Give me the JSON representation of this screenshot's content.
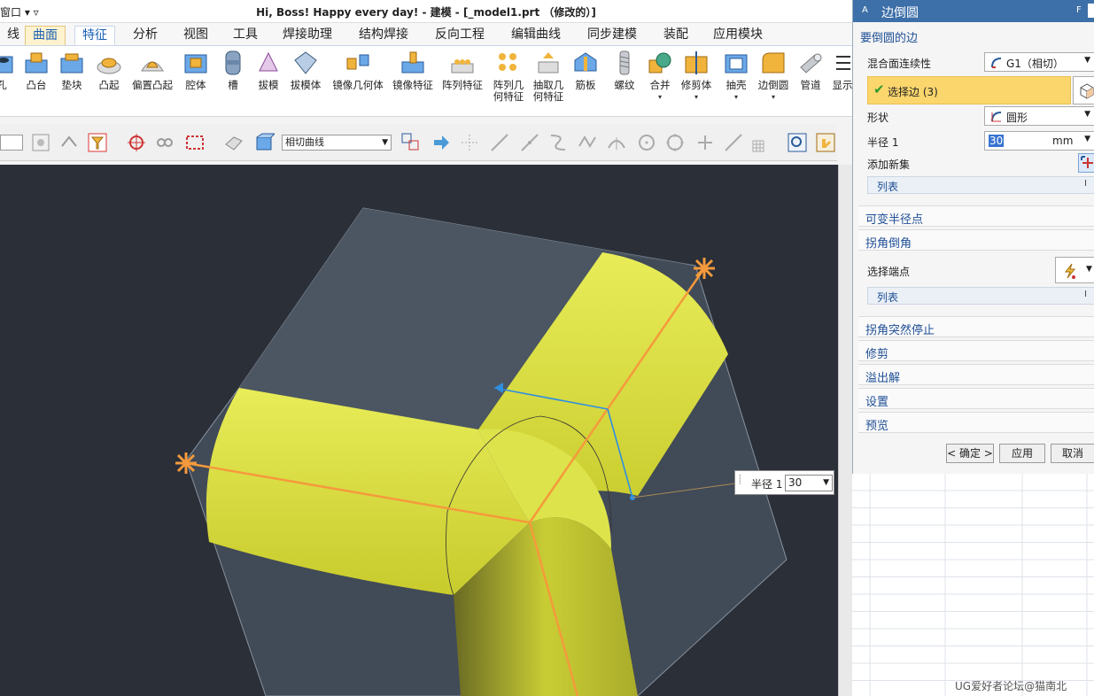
{
  "titlebar": {
    "quick_access": "窗口 ▾ ▿",
    "title": "Hi, Boss! Happy every day! - 建模 - [_model1.prt （修改的）]"
  },
  "tabs": [
    {
      "label": "线"
    },
    {
      "label": "曲面"
    },
    {
      "label": "特征"
    },
    {
      "label": "分析"
    },
    {
      "label": "视图"
    },
    {
      "label": "工具"
    },
    {
      "label": "焊接助理"
    },
    {
      "label": "结构焊接"
    },
    {
      "label": "反向工程"
    },
    {
      "label": "编辑曲线"
    },
    {
      "label": "同步建模"
    },
    {
      "label": "装配"
    },
    {
      "label": "应用模块"
    }
  ],
  "ribbon": {
    "buttons": [
      {
        "label": "孔",
        "icon": "hole-icon"
      },
      {
        "label": "凸台",
        "icon": "boss-icon"
      },
      {
        "label": "垫块",
        "icon": "pad-icon"
      },
      {
        "label": "凸起",
        "icon": "emboss-icon"
      },
      {
        "label": "偏置凸起",
        "icon": "offset-emboss-icon"
      },
      {
        "label": "腔体",
        "icon": "pocket-icon"
      },
      {
        "label": "槽",
        "icon": "groove-icon"
      },
      {
        "label": "拔模",
        "icon": "draft-icon"
      },
      {
        "label": "拔模体",
        "icon": "draft-body-icon"
      },
      {
        "label": "镜像几何体",
        "icon": "mirror-geometry-icon"
      },
      {
        "label": "镜像特征",
        "icon": "mirror-feature-icon"
      },
      {
        "label": "阵列特征",
        "icon": "pattern-feature-icon"
      },
      {
        "label": "阵列几何特征",
        "icon": "pattern-geometry-icon"
      },
      {
        "label": "抽取几何特征",
        "icon": "extract-geometry-icon"
      },
      {
        "label": "筋板",
        "icon": "rib-icon"
      },
      {
        "label": "螺纹",
        "icon": "thread-icon"
      },
      {
        "label": "合并",
        "icon": "unite-icon"
      },
      {
        "label": "修剪体",
        "icon": "trim-body-icon"
      },
      {
        "label": "抽壳",
        "icon": "shell-icon"
      },
      {
        "label": "边倒圆",
        "icon": "edge-blend-icon"
      },
      {
        "label": "管道",
        "icon": "tube-icon"
      },
      {
        "label": "显示",
        "icon": "display-icon"
      }
    ]
  },
  "toolbar": {
    "curve_rule": "相切曲线"
  },
  "viewport": {
    "radius_tip_label": "半径 1",
    "radius_tip_value": "30"
  },
  "dialog": {
    "title": "边倒圆",
    "title_left": "A",
    "title_right": "F",
    "section_edges": "要倒圆的边",
    "continuity_label": "混合面连续性",
    "continuity_value": "G1（相切）",
    "select_edge": "选择边 (3)",
    "shape_label": "形状",
    "shape_value": "圆形",
    "radius_label": "半径 1",
    "radius_value": "30",
    "radius_unit": "mm",
    "add_new_set": "添加新集",
    "list_label": "列表",
    "list_icon": "I",
    "section_variable_radius": "可变半径点",
    "section_corner_setback": "拐角倒角",
    "select_endpoint": "选择端点",
    "list2_label": "列表",
    "section_corner_stop": "拐角突然停止",
    "section_trim": "修剪",
    "section_overflow": "溢出解",
    "section_settings": "设置",
    "section_preview": "预览",
    "ok_button": "< 确定 >",
    "apply_button": "应用",
    "cancel_button": "取消"
  },
  "watermark": "UG爱好者论坛@猫南北",
  "colors": {
    "title_blue": "#3d6fa8",
    "selection_yellow": "#fbd66d",
    "model_yellow": "#dfe43c",
    "edge_orange": "#f59a3c",
    "vector_blue": "#2f8fe0",
    "viewport_bg": "#2b2f38"
  }
}
